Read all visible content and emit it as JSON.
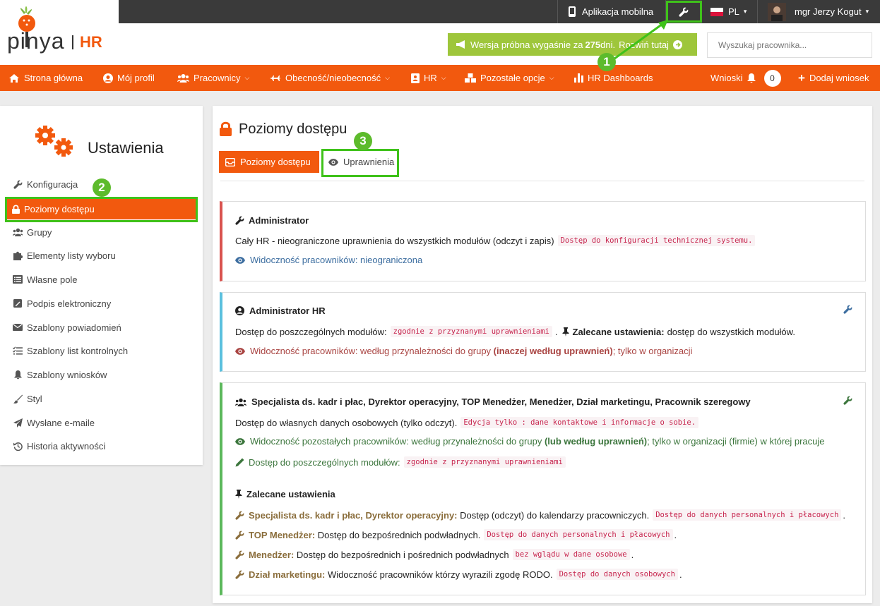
{
  "brand": {
    "logo_text": "pinya",
    "logo_suffix": "HR"
  },
  "topbar": {
    "mobile_app": "Aplikacja mobilna",
    "language": "PL",
    "user": "mgr Jerzy Kogut"
  },
  "header": {
    "trial_prefix": "Wersja próbna wygaśnie za ",
    "trial_days": "275",
    "trial_suffix": " dni.",
    "trial_link": "Rozwiń tutaj",
    "search_placeholder": "Wyszukaj pracownika..."
  },
  "nav": {
    "home": "Strona główna",
    "profile": "Mój profil",
    "employees": "Pracownicy",
    "attendance": "Obecność/nieobecność",
    "hr": "HR",
    "other": "Pozostałe opcje",
    "dashboards": "HR Dashboards",
    "requests": "Wnioski",
    "requests_count": "0",
    "add_request": "Dodaj wniosek"
  },
  "sidebar": {
    "title": "Ustawienia",
    "items": [
      "Konfiguracja",
      "Poziomy dostępu",
      "Grupy",
      "Elementy listy wyboru",
      "Własne pole",
      "Podpis elektroniczny",
      "Szablony powiadomień",
      "Szablony list kontrolnych",
      "Szablony wniosków",
      "Styl",
      "Wysłane e-maile",
      "Historia aktywności"
    ]
  },
  "main": {
    "title": "Poziomy dostępu",
    "tabs": [
      "Poziomy dostępu",
      "Uprawnienia"
    ],
    "cards": {
      "admin": {
        "title": "Administrator",
        "desc": "Cały HR - nieograniczone uprawnienia do wszystkich modułów (odczyt i zapis)",
        "code": "Dostęp do konfiguracji technicznej systemu.",
        "visibility": "Widoczność pracowników: nieograniczona"
      },
      "adminhr": {
        "title": "Administrator HR",
        "desc": "Dostęp do poszczególnych modułów:",
        "code": "zgodnie z przyznanymi uprawnieniami",
        "rec_label": "Zalecane ustawienia:",
        "rec_text": "dostęp do wszystkich modułów.",
        "vis_a": "Widoczność pracowników: według przynależności do grupy ",
        "vis_b": "(inaczej według uprawnień)",
        "vis_c": "; tylko w organizacji"
      },
      "specialist": {
        "title": "Specjalista ds. kadr i płac, Dyrektor operacyjny, TOP Menedżer, Menedżer, Dział marketingu, Pracownik szeregowy",
        "desc": "Dostęp do własnych danych osobowych (tylko odczyt).",
        "desc_code": "Edycja tylko : dane kontaktowe i informacje o sobie.",
        "vis_a": "Widoczność pozostałych pracowników: według przynależności do grupy ",
        "vis_b": "(lub według uprawnień)",
        "vis_c": "; tylko w organizacji (firmie) w której pracuje",
        "modules": "Dostęp do poszczególnych modułów:",
        "modules_code": "zgodnie z przyznanymi uprawnieniami",
        "rec_title": "Zalecane ustawienia",
        "rec": [
          {
            "label": "Specjalista ds. kadr i płac, Dyrektor operacyjny:",
            "text": " Dostęp (odczyt) do kalendarzy pracowniczych.",
            "code": "Dostęp do danych personalnych i płacowych"
          },
          {
            "label": "TOP Menedżer:",
            "text": " Dostęp do bezpośrednich podwładnych.",
            "code": "Dostęp do danych personalnych i płacowych"
          },
          {
            "label": "Menedżer:",
            "text": " Dostęp do bezpośrednich i pośrednich podwładnych",
            "code": "bez wglądu w dane osobowe"
          },
          {
            "label": "Dział marketingu:",
            "text": " Widoczność pracowników którzy wyrazili zgodę RODO.",
            "code": "Dostęp do danych osobowych"
          }
        ]
      }
    }
  },
  "annotations": {
    "one": "1",
    "two": "2",
    "three": "3"
  },
  "colors": {
    "accent": "#f2590e",
    "trial": "#9ec63b",
    "annotation": "#3fc21a"
  }
}
